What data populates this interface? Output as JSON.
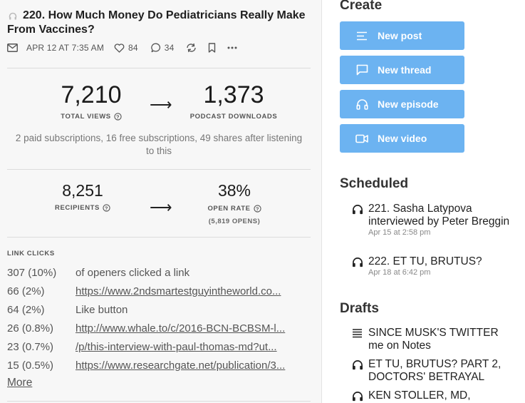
{
  "post": {
    "title": "220. How Much Money Do Pediatricians Really Make From Vaccines?",
    "date": "APR 12 AT 7:35 AM",
    "likes": "84",
    "comments": "34"
  },
  "stats1": {
    "left_value": "7,210",
    "left_label": "TOTAL VIEWS",
    "arrow": "⟶",
    "right_value": "1,373",
    "right_label": "PODCAST DOWNLOADS",
    "description": "2 paid subscriptions, 16 free subscriptions, 49 shares after listening to this"
  },
  "stats2": {
    "left_value": "8,251",
    "left_label": "RECIPIENTS",
    "arrow": "⟶",
    "right_value": "38%",
    "right_label": "OPEN RATE",
    "right_sub": "(5,819 OPENS)"
  },
  "link_clicks": {
    "title": "LINK CLICKS",
    "rows": [
      {
        "count": "307 (10%)",
        "label": "of openers clicked a link",
        "link": false
      },
      {
        "count": "66 (2%)",
        "label": "https://www.2ndsmartestguyintheworld.co...",
        "link": true
      },
      {
        "count": "64 (2%)",
        "label": "Like button",
        "link": false
      },
      {
        "count": "26 (0.8%)",
        "label": "http://www.whale.to/c/2016-BCN-BCBSM-l...",
        "link": true
      },
      {
        "count": "23 (0.7%)",
        "label": "/p/this-interview-with-paul-thomas-md?ut...",
        "link": true
      },
      {
        "count": "15 (0.5%)",
        "label": "https://www.researchgate.net/publication/3...",
        "link": true
      }
    ],
    "more": "More"
  },
  "create": {
    "title": "Create",
    "buttons": [
      {
        "label": "New post",
        "icon": "lines-icon"
      },
      {
        "label": "New thread",
        "icon": "chat-bubble-icon"
      },
      {
        "label": "New episode",
        "icon": "headphones-icon"
      },
      {
        "label": "New video",
        "icon": "video-camera-icon"
      }
    ]
  },
  "scheduled": {
    "title": "Scheduled",
    "items": [
      {
        "title": "221. Sasha Latypova interviewed by Peter Breggin",
        "date": "Apr 15 at 2:58 pm"
      },
      {
        "title": "222. ET TU, BRUTUS?",
        "date": "Apr 18 at 6:42 pm"
      }
    ]
  },
  "drafts": {
    "title": "Drafts",
    "items": [
      {
        "title": "SINCE MUSK'S TWITTER me on Notes",
        "icon": "lines-icon"
      },
      {
        "title": "ET TU, BRUTUS? PART 2, DOCTORS' BETRAYAL",
        "icon": "headphones-icon"
      },
      {
        "title": "KEN STOLLER, MD,",
        "icon": "headphones-icon"
      }
    ]
  },
  "colors": {
    "button": "#6cb3f1",
    "panel": "#f7f7f7"
  }
}
